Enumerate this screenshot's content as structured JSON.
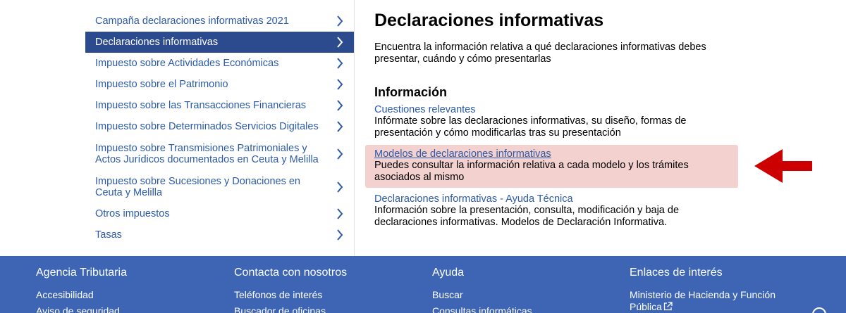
{
  "sidebar": {
    "items": [
      {
        "label": "Campaña declaraciones informativas 2021"
      },
      {
        "label": "Declaraciones informativas"
      },
      {
        "label": "Impuesto sobre Actividades Económicas"
      },
      {
        "label": "Impuesto sobre el Patrimonio"
      },
      {
        "label": "Impuesto sobre las Transacciones Financieras"
      },
      {
        "label": "Impuesto sobre Determinados Servicios Digitales"
      },
      {
        "label": "Impuesto sobre Transmisiones Patrimoniales y Actos Jurídicos documentados en Ceuta y Melilla"
      },
      {
        "label": "Impuesto sobre Sucesiones y Donaciones en Ceuta y Melilla"
      },
      {
        "label": "Otros impuestos"
      },
      {
        "label": "Tasas"
      }
    ],
    "active_index": 1
  },
  "main": {
    "title": "Declaraciones informativas",
    "intro": "Encuentra la información relativa a qué declaraciones informativas debes presentar, cuándo y cómo presentarlas",
    "section_title": "Información",
    "entries": [
      {
        "link": "Cuestiones relevantes",
        "desc": "Infórmate sobre las declaraciones informativas, su diseño, formas de presentación y cómo modificarlas tras su presentación"
      },
      {
        "link": "Modelos de declaraciones informativas",
        "desc": "Puedes consultar la información relativa a cada modelo y los trámites asociados al mismo"
      },
      {
        "link": "Declaraciones informativas - Ayuda Técnica",
        "desc": "Información sobre la presentación, consulta, modificación y baja de declaraciones informativas. Modelos de Declaración Informativa."
      }
    ]
  },
  "footer": {
    "columns": [
      {
        "heading": "Agencia Tributaria",
        "links": [
          "Accesibilidad",
          "Aviso de seguridad"
        ]
      },
      {
        "heading": "Contacta con nosotros",
        "links": [
          "Teléfonos de interés",
          "Buscador de oficinas"
        ]
      },
      {
        "heading": "Ayuda",
        "links": [
          "Buscar",
          "Consultas informáticas"
        ]
      },
      {
        "heading": "Enlaces de interés",
        "links": [
          "Ministerio de Hacienda y Función Pública"
        ]
      }
    ]
  },
  "colors": {
    "link": "#2c5aa9",
    "active_bg": "#2b4b8e",
    "highlight_bg": "#f3d1cf",
    "arrow": "#cc0000",
    "footer_bg": "#3d65b4"
  },
  "icons": {
    "sidebar_chevron": "chevron-right-icon",
    "annotation_arrow": "arrow-left-icon",
    "external_link": "external-link-icon"
  }
}
